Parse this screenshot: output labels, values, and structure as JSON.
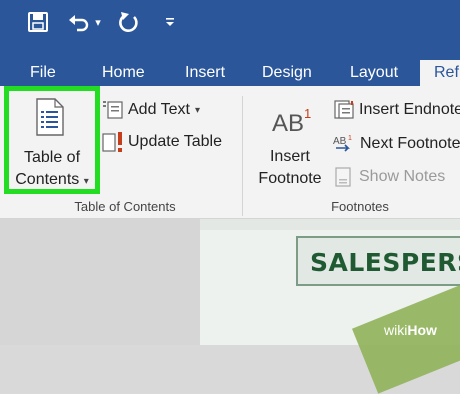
{
  "qat": {
    "save_icon": "save-icon",
    "undo_icon": "undo-icon",
    "undo_dropdown": "▾",
    "redo_icon": "redo-icon",
    "customize_icon": "customize-qat-icon"
  },
  "tabs": [
    {
      "label": "File"
    },
    {
      "label": "Home"
    },
    {
      "label": "Insert"
    },
    {
      "label": "Design"
    },
    {
      "label": "Layout"
    },
    {
      "label": "Ref"
    }
  ],
  "toc_group": {
    "toc_button_line1": "Table of",
    "toc_button_line2": "Contents",
    "add_text": "Add Text",
    "update_table": "Update Table",
    "group_label": "Table of Contents"
  },
  "footnotes_group": {
    "insert_footnote_line1": "Insert",
    "insert_footnote_line2": "Footnote",
    "insert_endnote": "Insert Endnote",
    "next_footnote": "Next Footnote",
    "show_notes": "Show Notes",
    "group_label": "Footnotes"
  },
  "document": {
    "banner_text": "SALESPERSON"
  },
  "watermark": {
    "prefix": "wiki",
    "suffix": "How"
  },
  "colors": {
    "ribbon_blue": "#2b579a",
    "highlight_green": "#22dd22",
    "banner_green": "#1f5a32",
    "alert_red": "#c43e1c"
  }
}
